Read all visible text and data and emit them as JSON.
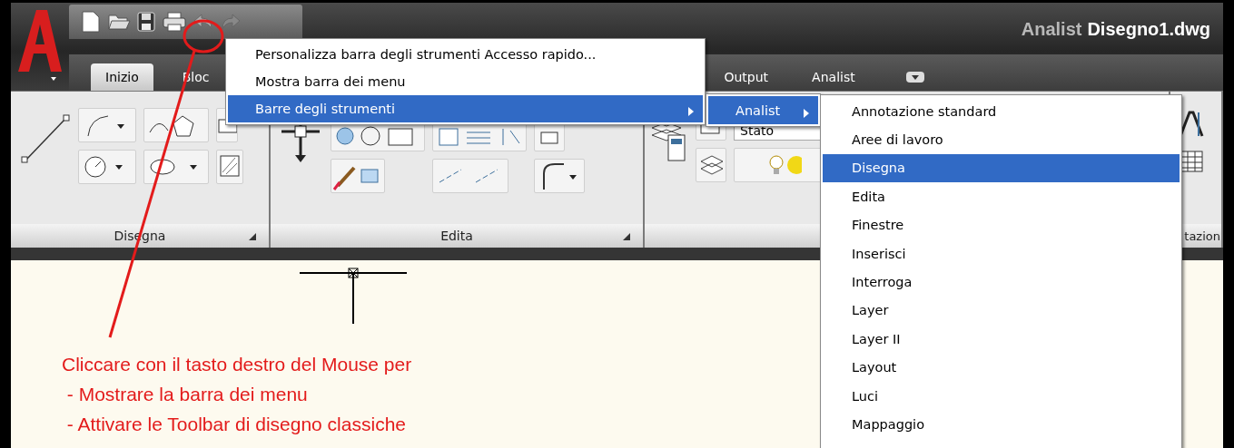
{
  "title": {
    "app": "Analist",
    "file": "Disegno1.dwg"
  },
  "tabs": [
    {
      "label": "Inizio",
      "selected": true
    },
    {
      "label": "Bloc",
      "selected": false
    },
    {
      "label": "Output",
      "selected": false
    },
    {
      "label": "Analist",
      "selected": false
    }
  ],
  "ribbon": {
    "panels": [
      {
        "label": "Disegna"
      },
      {
        "label": "Edita"
      },
      {
        "label": "tazion"
      }
    ],
    "layer_state": "Stato"
  },
  "context_menu": {
    "items": [
      {
        "label": "Personalizza barra degli strumenti Accesso rapido...",
        "selected": false,
        "submenu": false
      },
      {
        "label": "Mostra barra dei menu",
        "selected": false,
        "submenu": false
      },
      {
        "label": "Barre degli strumenti",
        "selected": true,
        "submenu": true
      }
    ]
  },
  "submenu": {
    "items": [
      {
        "label": "Analist",
        "selected": true,
        "submenu": true
      }
    ]
  },
  "toolbars_menu": {
    "items": [
      {
        "label": "Annotazione standard",
        "selected": false
      },
      {
        "label": "Aree di lavoro",
        "selected": false
      },
      {
        "label": "Disegna",
        "selected": true
      },
      {
        "label": "Edita",
        "selected": false
      },
      {
        "label": "Finestre",
        "selected": false
      },
      {
        "label": "Inserisci",
        "selected": false
      },
      {
        "label": "Interroga",
        "selected": false
      },
      {
        "label": "Layer",
        "selected": false
      },
      {
        "label": "Layer II",
        "selected": false
      },
      {
        "label": "Layout",
        "selected": false
      },
      {
        "label": "Luci",
        "selected": false
      },
      {
        "label": "Mappaggio",
        "selected": false
      }
    ]
  },
  "annotation": {
    "lines": [
      "Cliccare con il tasto destro del Mouse per",
      " - Mostrare la barra dei menu",
      " - Attivare le Toolbar di disegno classiche"
    ]
  }
}
